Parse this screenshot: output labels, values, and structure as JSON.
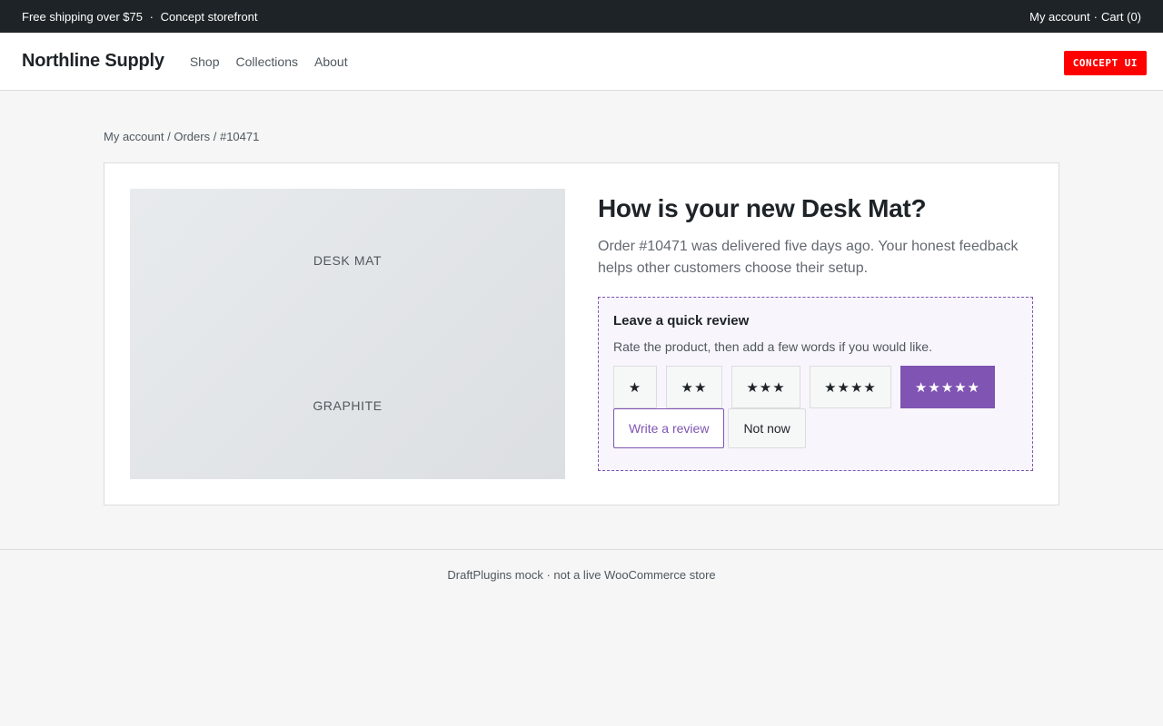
{
  "topbar": {
    "promo": "Free shipping over $75",
    "separator": "·",
    "tagline": "Concept storefront",
    "account_link": "My account",
    "cart_link": "Cart (0)"
  },
  "header": {
    "brand": "Northline Supply",
    "nav": [
      {
        "label": "Shop"
      },
      {
        "label": "Collections"
      },
      {
        "label": "About"
      }
    ],
    "badge": "CONCEPT UI"
  },
  "breadcrumb": {
    "items": [
      "My account",
      "Orders",
      "#10471"
    ],
    "separator": "/"
  },
  "product": {
    "image_name": "DESK MAT",
    "image_color": "GRAPHITE"
  },
  "content": {
    "title": "How is your new Desk Mat?",
    "description": "Order #10471 was delivered five days ago. Your honest feedback helps other customers choose their setup."
  },
  "review": {
    "title": "Leave a quick review",
    "subtitle": "Rate the product, then add a few words if you would like.",
    "ratings": [
      "★",
      "★★",
      "★★★",
      "★★★★",
      "★★★★★"
    ],
    "selected_rating": 5,
    "write_label": "Write a review",
    "not_now_label": "Not now"
  },
  "footer": {
    "text": "DraftPlugins mock · not a live WooCommerce store"
  },
  "colors": {
    "accent": "#7f54b3",
    "topbar": "#1d2327",
    "badge": "#ff0000"
  }
}
